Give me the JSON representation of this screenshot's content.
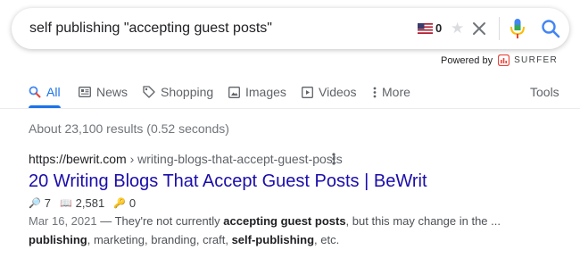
{
  "search": {
    "query": "self publishing \"accepting guest posts\"",
    "flag_count": "0",
    "icons": [
      "us-flag-icon",
      "star-icon",
      "clear-icon",
      "mic-icon",
      "search-icon"
    ]
  },
  "powered_by": {
    "label": "Powered by",
    "brand": "SURFER",
    "brand_color": "#e8453c"
  },
  "tabs": [
    {
      "label": "All",
      "icon": "search-icon",
      "active": true
    },
    {
      "label": "News",
      "icon": "news-icon"
    },
    {
      "label": "Shopping",
      "icon": "tag-icon"
    },
    {
      "label": "Images",
      "icon": "image-icon"
    },
    {
      "label": "Videos",
      "icon": "play-icon"
    },
    {
      "label": "More",
      "icon": "more-icon"
    }
  ],
  "tools_label": "Tools",
  "result_stats": "About 23,100 results (0.52 seconds)",
  "result": {
    "url_domain": "https://bewrit.com",
    "url_path": " › writing-blogs-that-accept-guest-posts",
    "title": "20 Writing Blogs That Accept Guest Posts | BeWrit",
    "metrics": [
      {
        "icon": "🔎",
        "value": "7"
      },
      {
        "icon": "📖",
        "value": "2,581"
      },
      {
        "icon": "🔑",
        "value": "0"
      }
    ],
    "snippet_line1": {
      "date": "Mar 16, 2021",
      "sep": " — They're not currently ",
      "bold1": "accepting guest posts",
      "rest": ", but this may change in the ..."
    },
    "snippet_line2": {
      "bold1": "publishing",
      "mid": ", marketing, branding, craft, ",
      "bold2": "self-publishing",
      "rest": ", etc."
    }
  },
  "colors": {
    "link_title": "#1a0dab",
    "accent_blue": "#1a73e8",
    "muted": "#70757a"
  }
}
